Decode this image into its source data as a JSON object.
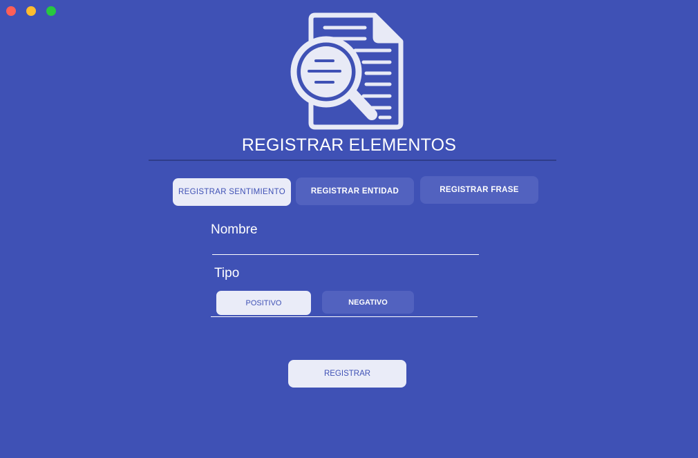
{
  "window": {
    "controls": [
      "close",
      "minimize",
      "maximize"
    ]
  },
  "header": {
    "logo_icon": "document-search-icon",
    "title": "REGISTRAR ELEMENTOS"
  },
  "tabs": [
    {
      "label": "REGISTRAR SENTIMIENTO",
      "active": true
    },
    {
      "label": "REGISTRAR ENTIDAD",
      "active": false
    },
    {
      "label": "REGISTRAR FRASE",
      "active": false
    }
  ],
  "form": {
    "nombre_label": "Nombre",
    "nombre_value": "",
    "tipo_label": "Tipo",
    "tipo_options": [
      {
        "label": "POSITIVO",
        "selected": true
      },
      {
        "label": "NEGATIVO",
        "selected": false
      }
    ],
    "submit_label": "REGISTRAR"
  },
  "colors": {
    "background": "#3f51b5",
    "active_button": "#eaecf8",
    "inactive_button": "#5262bf",
    "close": "#fe5f57",
    "minimize": "#febc2e",
    "maximize": "#28c840"
  }
}
